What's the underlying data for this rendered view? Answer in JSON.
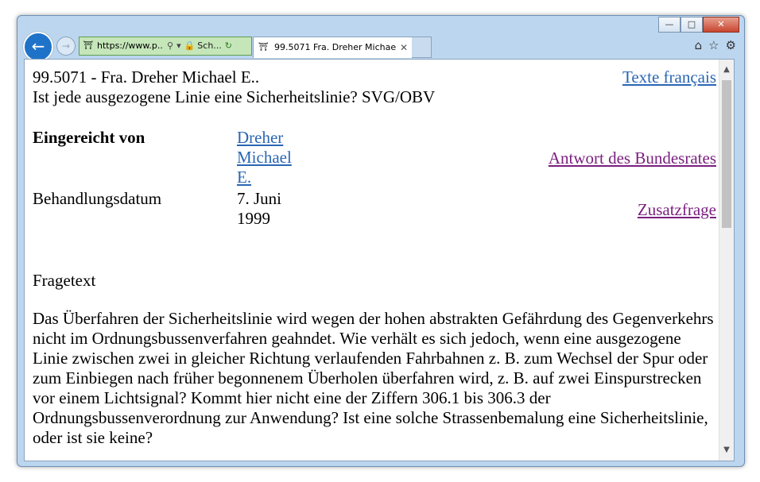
{
  "browser": {
    "url": "https://www.p..",
    "site_label": "Sch...",
    "tab_title": "99.5071 Fra. Dreher Michael..."
  },
  "page": {
    "lang_link": "Texte français",
    "title_line1": "99.5071 - Fra. Dreher Michael E..",
    "title_line2": "Ist jede ausgezogene Linie eine Sicherheitslinie? SVG/OBV",
    "submitted_label": "Eingereicht von",
    "submitted_by": "Dreher Michael E.",
    "date_label": "Behandlungsdatum",
    "date_value": "7. Juni 1999",
    "answer_link": "Antwort des Bundesrates",
    "additional_link": "Zusatzfrage",
    "question_label": "Fragetext",
    "question_text": "Das Überfahren der Sicherheitslinie wird wegen der hohen abstrakten Gefährdung des Gegenverkehrs nicht im Ordnungsbussenverfahren geahndet. Wie verhält es sich jedoch, wenn eine ausgezogene Linie zwischen zwei in gleicher Richtung verlaufenden Fahrbahnen z. B. zum Wechsel der Spur oder zum Einbiegen nach früher begonnenem Überholen überfahren wird, z. B. auf zwei Einspurstrecken vor einem Lichtsignal? Kommt hier nicht eine der Ziffern 306.1 bis 306.3 der Ordnungsbussenverordnung zur Anwendung? Ist eine solche Strassenbemalung eine Sicherheitslinie, oder ist sie keine?"
  },
  "icons": {
    "back": "back-arrow-icon",
    "forward": "forward-arrow-icon",
    "search": "search-icon",
    "lock": "lock-icon",
    "refresh": "refresh-icon",
    "home": "home-icon",
    "favorites": "star-icon",
    "settings": "gear-icon"
  },
  "colors": {
    "link": "#2a66b3",
    "visited_link": "#7a1f7f",
    "address_bar": "#c5e6b9"
  }
}
